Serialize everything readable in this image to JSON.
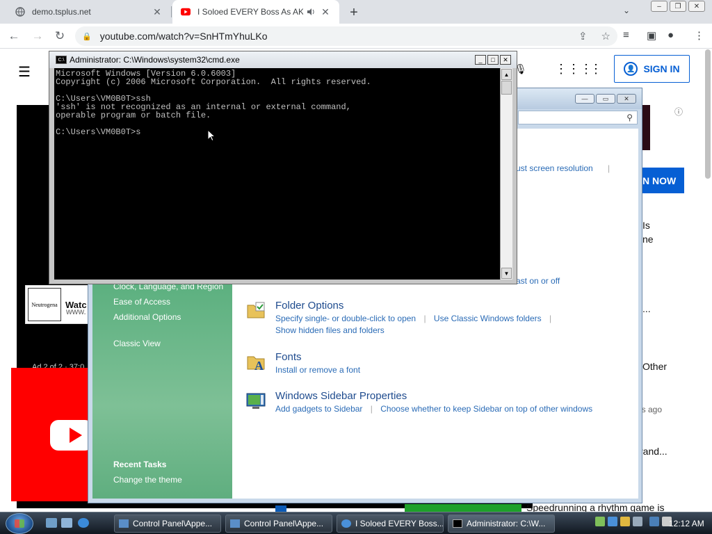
{
  "browser": {
    "tabs": [
      {
        "title": "demo.tsplus.net"
      },
      {
        "title": "I Soloed EVERY Boss As AKA"
      }
    ],
    "url": "youtube.com/watch?v=SnHTmYhuLKo"
  },
  "youtube": {
    "signin_label": "SIGN IN",
    "ad": {
      "logo_text": "Neutrogena",
      "title": "Watc",
      "sub": "www.",
      "count": "Ad 2 of 2 · 37:0"
    },
    "join_label": "N NOW",
    "side": {
      "t1": "Is",
      "t2": "ne",
      "t3": "...",
      "t4": "Other",
      "t5": "hs ago",
      "t6": "rand..."
    },
    "bottom_caption": "Speedrunning a rhythm game is"
  },
  "control_panel": {
    "sidebar_top": "Clock, Language, and Region",
    "sidebar_links": [
      "Ease of Access",
      "Additional Options"
    ],
    "classic_view": "Classic View",
    "recent_tasks_heading": "Recent Tasks",
    "recent_tasks": [
      "Change the theme"
    ],
    "frag_resolution": "ust screen resolution",
    "frag_on_off": "ast on or off",
    "items": [
      {
        "name": "Folder Options",
        "links": [
          "Specify single- or double-click to open",
          "Use Classic Windows folders",
          "Show hidden files and folders"
        ]
      },
      {
        "name": "Fonts",
        "links": [
          "Install or remove a font"
        ]
      },
      {
        "name": "Windows Sidebar Properties",
        "links": [
          "Add gadgets to Sidebar",
          "Choose whether to keep Sidebar on top of other windows"
        ]
      }
    ]
  },
  "cmd": {
    "title": "Administrator: C:\\Windows\\system32\\cmd.exe",
    "lines": [
      "Microsoft Windows [Version 6.0.6003]",
      "Copyright (c) 2006 Microsoft Corporation.  All rights reserved.",
      "",
      "C:\\Users\\VM0B0T>ssh",
      "'ssh' is not recognized as an internal or external command,",
      "operable program or batch file.",
      "",
      "C:\\Users\\VM0B0T>s"
    ]
  },
  "taskbar": {
    "tasks": [
      {
        "label": "Control Panel\\Appe..."
      },
      {
        "label": "Control Panel\\Appe..."
      },
      {
        "label": "I Soloed EVERY Boss..."
      },
      {
        "label": "Administrator: C:\\W..."
      }
    ],
    "clock": "12:12 AM"
  },
  "colors": {
    "youtube_red": "#ff0000",
    "youtube_blue": "#065fd4",
    "cmd_text": "#c0c0c0",
    "cp_link": "#2a6bb6",
    "cp_heading": "#1e4b8e"
  }
}
